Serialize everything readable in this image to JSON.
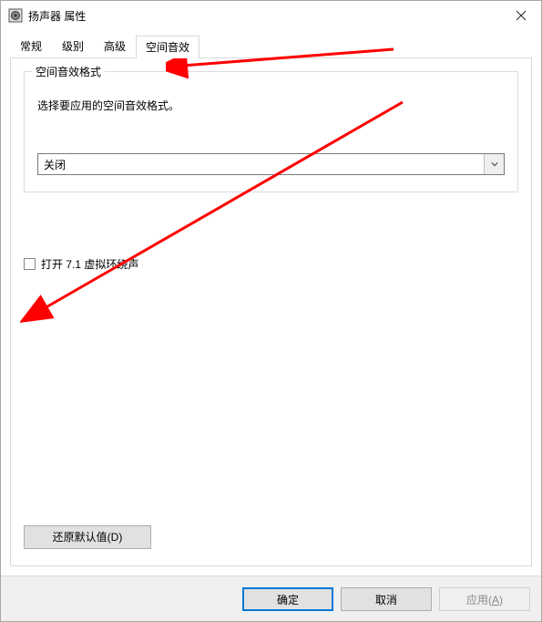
{
  "window": {
    "title": "扬声器 属性"
  },
  "tabs": {
    "general": "常规",
    "levels": "级别",
    "advanced": "高级",
    "spatial": "空间音效"
  },
  "group": {
    "title": "空间音效格式",
    "caption": "选择要应用的空间音效格式。"
  },
  "dropdown": {
    "value": "关闭"
  },
  "checkbox": {
    "label": "打开 7.1 虚拟环绕声"
  },
  "buttons": {
    "restore": "还原默认值(D)",
    "ok": "确定",
    "cancel": "取消",
    "apply": "应用(A)"
  }
}
